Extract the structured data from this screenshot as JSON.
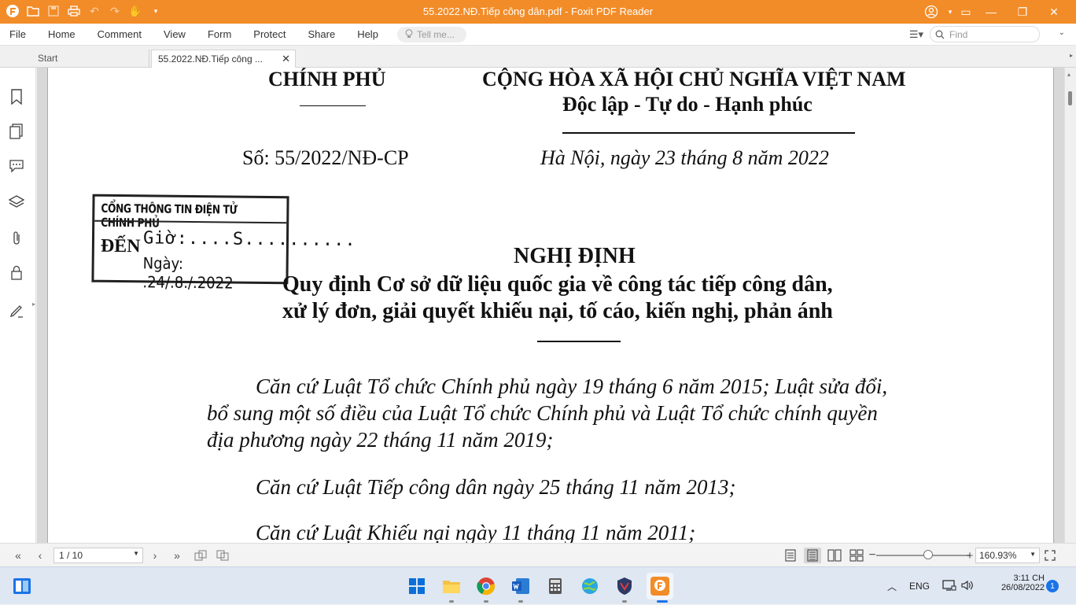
{
  "titlebar": {
    "title": "55.2022.NĐ.Tiếp công dân.pdf - Foxit PDF Reader"
  },
  "menu": {
    "items": [
      "File",
      "Home",
      "Comment",
      "View",
      "Form",
      "Protect",
      "Share",
      "Help"
    ],
    "tell_me_placeholder": "Tell me...",
    "find_placeholder": "Find"
  },
  "tabs": {
    "start": "Start",
    "doc": "55.2022.NĐ.Tiếp công ..."
  },
  "document": {
    "header_left": "CHÍNH PHỦ",
    "header_right": "CỘNG HÒA XÃ HỘI CHỦ NGHĨA VIỆT NAM",
    "motto": "Độc lập - Tự do - Hạnh phúc",
    "number": "Số: 55/2022/NĐ-CP",
    "place_date": "Hà Nội, ngày 23 tháng 8 năm 2022",
    "stamp": {
      "header": "CỔNG THÔNG TIN ĐIỆN TỬ CHÍNH PHỦ",
      "den": "ĐẾN",
      "so": "Giờ:....S..........",
      "ngay": "Ngày: .24/.8./.2022"
    },
    "title": "NGHỊ ĐỊNH",
    "subtitle_line1": "Quy định Cơ sở dữ liệu quốc gia về công tác tiếp công dân,",
    "subtitle_line2": "xử lý đơn, giải quyết khiếu nại, tố cáo, kiến nghị, phản ánh",
    "para1_line1": "Căn cứ Luật Tổ chức Chính phủ ngày 19 tháng 6 năm 2015; Luật sửa đổi,",
    "para1_line2": "bổ sung một số điều của Luật Tổ chức Chính phủ và Luật Tổ chức chính quyền",
    "para1_line3": "địa phương ngày 22 tháng 11 năm 2019;",
    "para2": "Căn cứ Luật Tiếp công dân ngày 25 tháng 11 năm 2013;",
    "para3": "Căn cứ Luật Khiếu nại ngày 11 tháng 11 năm 2011;"
  },
  "statusbar": {
    "page_indicator": "1 / 10",
    "zoom": "160.93%"
  },
  "taskbar": {
    "language": "ENG",
    "time": "3:11 CH",
    "date": "26/08/2022",
    "notification_count": "1"
  },
  "colors": {
    "titlebar": "#f28c28",
    "accent": "#1a73e8"
  }
}
